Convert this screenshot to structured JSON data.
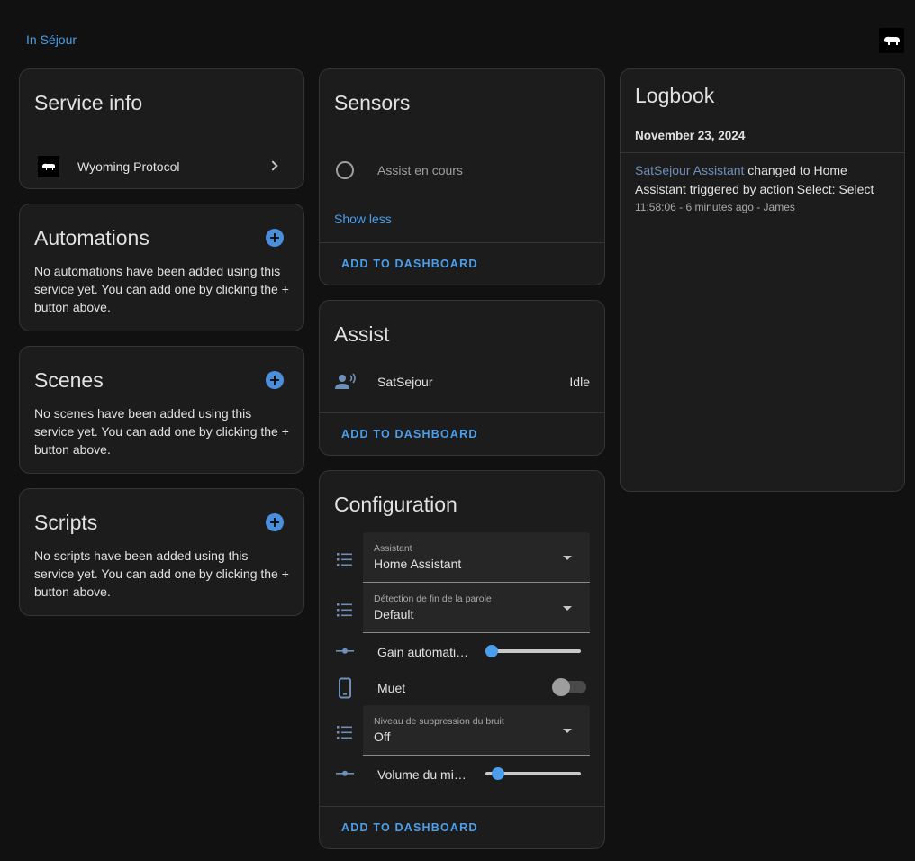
{
  "breadcrumb": {
    "area": "In Séjour"
  },
  "service_info": {
    "title": "Service info",
    "integration": "Wyoming Protocol"
  },
  "automations": {
    "title": "Automations",
    "description": "No automations have been added using this service yet. You can add one by clicking the + button above."
  },
  "scenes": {
    "title": "Scenes",
    "description": "No scenes have been added using this service yet. You can add one by clicking the + button above."
  },
  "scripts": {
    "title": "Scripts",
    "description": "No scripts have been added using this service yet. You can add one by clicking the + button above."
  },
  "sensors": {
    "title": "Sensors",
    "entity": "Assist en cours",
    "show_less": "Show less",
    "add_to_dashboard": "ADD TO DASHBOARD"
  },
  "assist": {
    "title": "Assist",
    "entity": "SatSejour",
    "state": "Idle",
    "add_to_dashboard": "ADD TO DASHBOARD"
  },
  "configuration": {
    "title": "Configuration",
    "assistant": {
      "label": "Assistant",
      "value": "Home Assistant"
    },
    "end_of_speech": {
      "label": "Détection de fin de la parole",
      "value": "Default"
    },
    "auto_gain": {
      "label": "Gain automati…",
      "value": 0
    },
    "mute": {
      "label": "Muet",
      "on": false
    },
    "noise_suppression": {
      "label": "Niveau de suppression du bruit",
      "value": "Off"
    },
    "mic_volume": {
      "label": "Volume du mi…",
      "value": 0.08
    },
    "add_to_dashboard": "ADD TO DASHBOARD"
  },
  "logbook": {
    "title": "Logbook",
    "date": "November 23, 2024",
    "entry": {
      "entity": "SatSejour Assistant",
      "message": " changed to Home Assistant triggered by action Select: Select",
      "meta": "11:58:06 - 6 minutes ago - James"
    }
  },
  "colors": {
    "accent": "#4a9eeb",
    "card_bg": "#1c1c1c",
    "page_bg": "#111111"
  }
}
